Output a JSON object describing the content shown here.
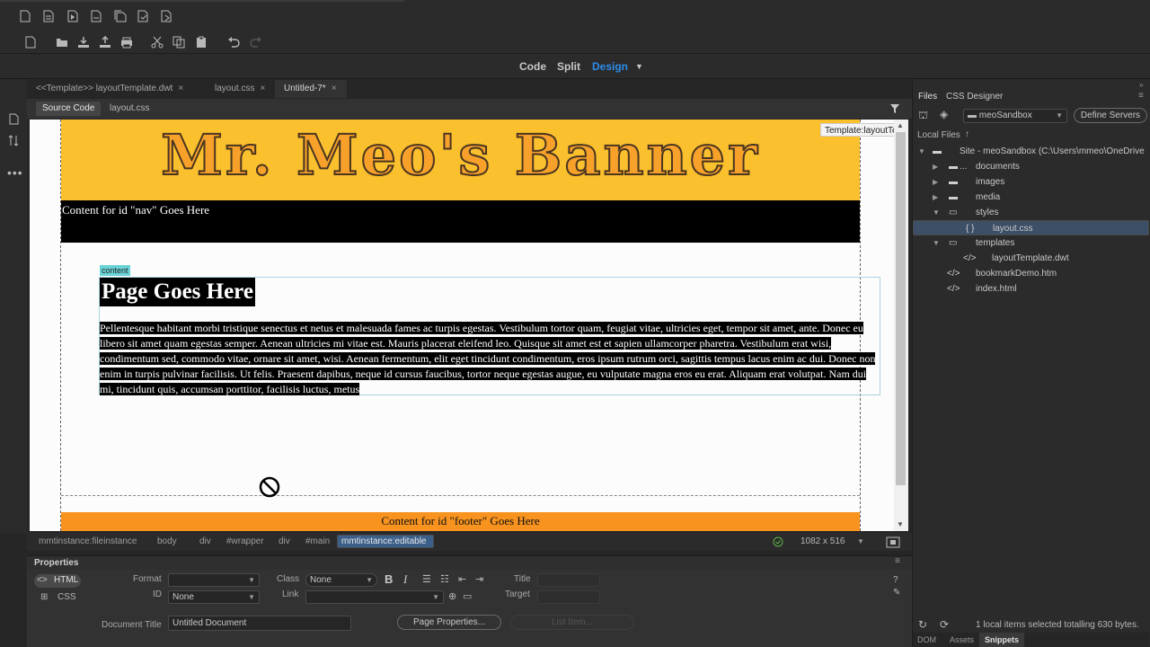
{
  "toolbar": {
    "row1_icons": [
      "new-file-icon",
      "open-file-icon",
      "play-icon",
      "document-icon",
      "copy-document-icon",
      "check-document-icon",
      "file-compare-icon"
    ],
    "row2_icons": [
      "new-icon",
      "folder-icon",
      "download-icon",
      "upload-icon",
      "print-icon",
      "cut-icon",
      "copy-icon",
      "paste-icon",
      "undo-icon",
      "redo-icon"
    ]
  },
  "views": {
    "code": "Code",
    "split": "Split",
    "design": "Design"
  },
  "accent": "#2d8ceb",
  "doc_tabs": [
    {
      "label": "<<Template>> layoutTemplate.dwt",
      "close": "×"
    },
    {
      "label": "layout.css",
      "close": "×"
    },
    {
      "label": "Untitled-7*",
      "close": "×"
    }
  ],
  "sub_tabs": {
    "source": "Source Code",
    "css": "layout.css"
  },
  "canvas": {
    "template_tag": "Template:layoutTemplate",
    "banner": "Mr. Meo's Banner",
    "nav": "Content for id \"nav\" Goes Here",
    "content_tag": "content",
    "heading": "Page Goes Here",
    "paragraph": "Pellentesque habitant morbi tristique senectus et netus et malesuada fames ac turpis egestas. Vestibulum tortor quam, feugiat vitae, ultricies eget, tempor sit amet, ante. Donec eu libero sit amet quam egestas semper. Aenean ultricies mi vitae est. Mauris placerat eleifend leo. Quisque sit amet est et sapien ullamcorper pharetra. Vestibulum erat wisi, condimentum sed, commodo vitae, ornare sit amet, wisi. Aenean fermentum, elit eget tincidunt condimentum, eros ipsum rutrum orci, sagittis tempus lacus enim ac dui. Donec non enim in turpis pulvinar facilisis. Ut felis. Praesent dapibus, neque id cursus faucibus, tortor neque egestas augue, eu vulputate magna eros eu erat. Aliquam erat volutpat. Nam dui mi, tincidunt quis, accumsan porttitor, facilisis luctus, metus",
    "footer": "Content for id \"footer\" Goes Here"
  },
  "tag_selector": [
    "mmtinstance:fileinstance",
    "body",
    "div",
    "#wrapper",
    "div",
    "#main",
    "mmtinstance:editable"
  ],
  "window_size": "1082 x 516",
  "properties": {
    "title": "Properties",
    "html": "HTML",
    "css": "CSS",
    "format_label": "Format",
    "format_value": "",
    "id_label": "ID",
    "id_value": "None",
    "class_label": "Class",
    "class_value": "None",
    "link_label": "Link",
    "title_label": "Title",
    "target_label": "Target",
    "doc_title_label": "Document Title",
    "doc_title_value": "Untitled Document",
    "page_props": "Page Properties...",
    "list_item": "List Item..."
  },
  "files_panel": {
    "tabs": {
      "files": "Files",
      "css": "CSS Designer"
    },
    "site": "meoSandbox",
    "define": "Define Servers",
    "local_files": "Local Files",
    "tree": [
      {
        "label": "Site - meoSandbox (C:\\Users\\mmeo\\OneDrive ...",
        "level": 0,
        "kind": "site"
      },
      {
        "label": "documents",
        "level": 1,
        "kind": "folder"
      },
      {
        "label": "images",
        "level": 1,
        "kind": "folder"
      },
      {
        "label": "media",
        "level": 1,
        "kind": "folder"
      },
      {
        "label": "styles",
        "level": 1,
        "kind": "folder-open"
      },
      {
        "label": "layout.css",
        "level": 2,
        "kind": "css"
      },
      {
        "label": "templates",
        "level": 1,
        "kind": "folder-open"
      },
      {
        "label": "layoutTemplate.dwt",
        "level": 2,
        "kind": "code"
      },
      {
        "label": "bookmarkDemo.htm",
        "level": 1,
        "kind": "code"
      },
      {
        "label": "index.html",
        "level": 1,
        "kind": "code"
      }
    ],
    "status": "1 local items selected totalling 630 bytes.",
    "bottom_tabs": {
      "dom": "DOM",
      "assets": "Assets",
      "snippets": "Snippets"
    }
  }
}
